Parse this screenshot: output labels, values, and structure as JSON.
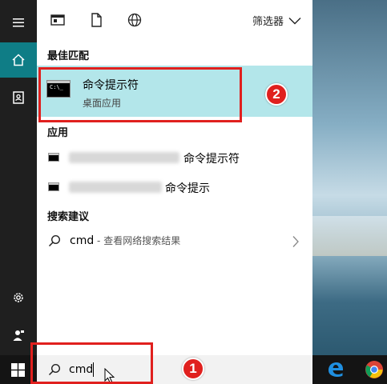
{
  "toolbar": {
    "filter_label": "筛选器"
  },
  "sections": {
    "best_match": "最佳匹配",
    "apps": "应用",
    "suggestions": "搜索建议"
  },
  "best_match": {
    "title": "命令提示符",
    "subtitle": "桌面应用",
    "icon_text": "C:\\_"
  },
  "apps": [
    {
      "label": "命令提示符"
    },
    {
      "label": "命令提示"
    }
  ],
  "suggestion": {
    "query": "cmd",
    "subtitle": " - 查看网络搜索结果"
  },
  "search": {
    "value": "cmd"
  },
  "annotations": {
    "badge1": "1",
    "badge2": "2",
    "color": "#e0201e"
  },
  "colors": {
    "accent": "#0f7d86",
    "highlight": "#b3e6ea",
    "rail": "#1f1f1f"
  }
}
